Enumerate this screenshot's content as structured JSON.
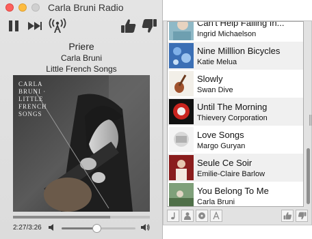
{
  "window": {
    "title": "Carla Bruni Radio"
  },
  "now_playing": {
    "title": "Priere",
    "artist": "Carla Bruni",
    "album": "Little French Songs",
    "album_art_text": "CARLA BRUNI · LITTLE FRENCH SONGS",
    "elapsed": "2:27",
    "duration": "3:26",
    "time_label": "2:27/3:26",
    "progress": 0.71,
    "volume": 0.47
  },
  "toolbar": {
    "pause_icon": "pause-icon",
    "skip_icon": "skip-forward-icon",
    "station_icon": "radio-tower-icon",
    "thumbs_up_icon": "thumbs-up-icon",
    "thumbs_down_icon": "thumbs-down-icon"
  },
  "history": [
    {
      "title": "Can't Help Falling In...",
      "artist": "Ingrid Michaelson"
    },
    {
      "title": "Nine Milllion Bicycles",
      "artist": "Katie Melua"
    },
    {
      "title": "Slowly",
      "artist": "Swan Dive"
    },
    {
      "title": "Until The Morning",
      "artist": "Thievery Corporation"
    },
    {
      "title": "Love Songs",
      "artist": "Margo Guryan"
    },
    {
      "title": "Seule Ce Soir",
      "artist": "Emilie-Claire Barlow"
    },
    {
      "title": "You Belong To Me",
      "artist": "Carla Bruni"
    }
  ],
  "drawer_footer": {
    "left_icons": [
      "music-note-icon",
      "artist-icon",
      "album-icon",
      "lyrics-icon"
    ],
    "right_icons": [
      "thumbs-up-icon",
      "thumbs-down-icon"
    ]
  },
  "colors": {
    "close": "#fc605c",
    "minimize": "#fdbc40",
    "zoom": "#d0d0d0"
  }
}
